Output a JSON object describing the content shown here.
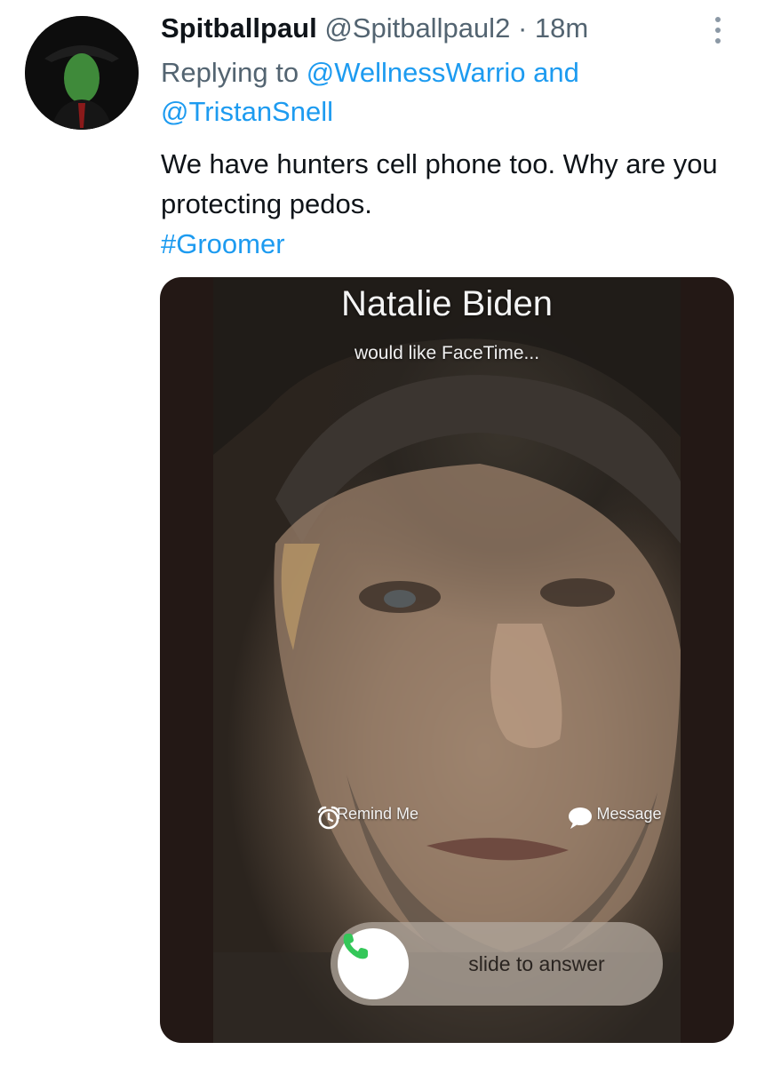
{
  "tweet": {
    "display_name": "Spitballpaul",
    "handle": "@Spitballpaul2",
    "separator": "·",
    "time": "18m",
    "replying_prefix": "Replying to",
    "reply_mention_1": "@WellnessWarrio",
    "reply_conjunction": "and",
    "reply_mention_2": "@TristanSnell",
    "text": "We have hunters cell phone too. Why are you protecting pedos.",
    "hashtag": "#Groomer"
  },
  "media": {
    "caller_name": "Natalie Biden",
    "subtitle": "would like FaceTime...",
    "remind_label": "Remind Me",
    "remind_icon": "alarm-clock-icon",
    "message_label": "Message",
    "message_icon": "speech-bubble-icon",
    "slider_label": "slide to answer",
    "answer_icon": "phone-icon"
  },
  "colors": {
    "link": "#1d9bf0",
    "secondary_text": "#536471",
    "primary_text": "#0f1419",
    "answer_green": "#34c759"
  }
}
